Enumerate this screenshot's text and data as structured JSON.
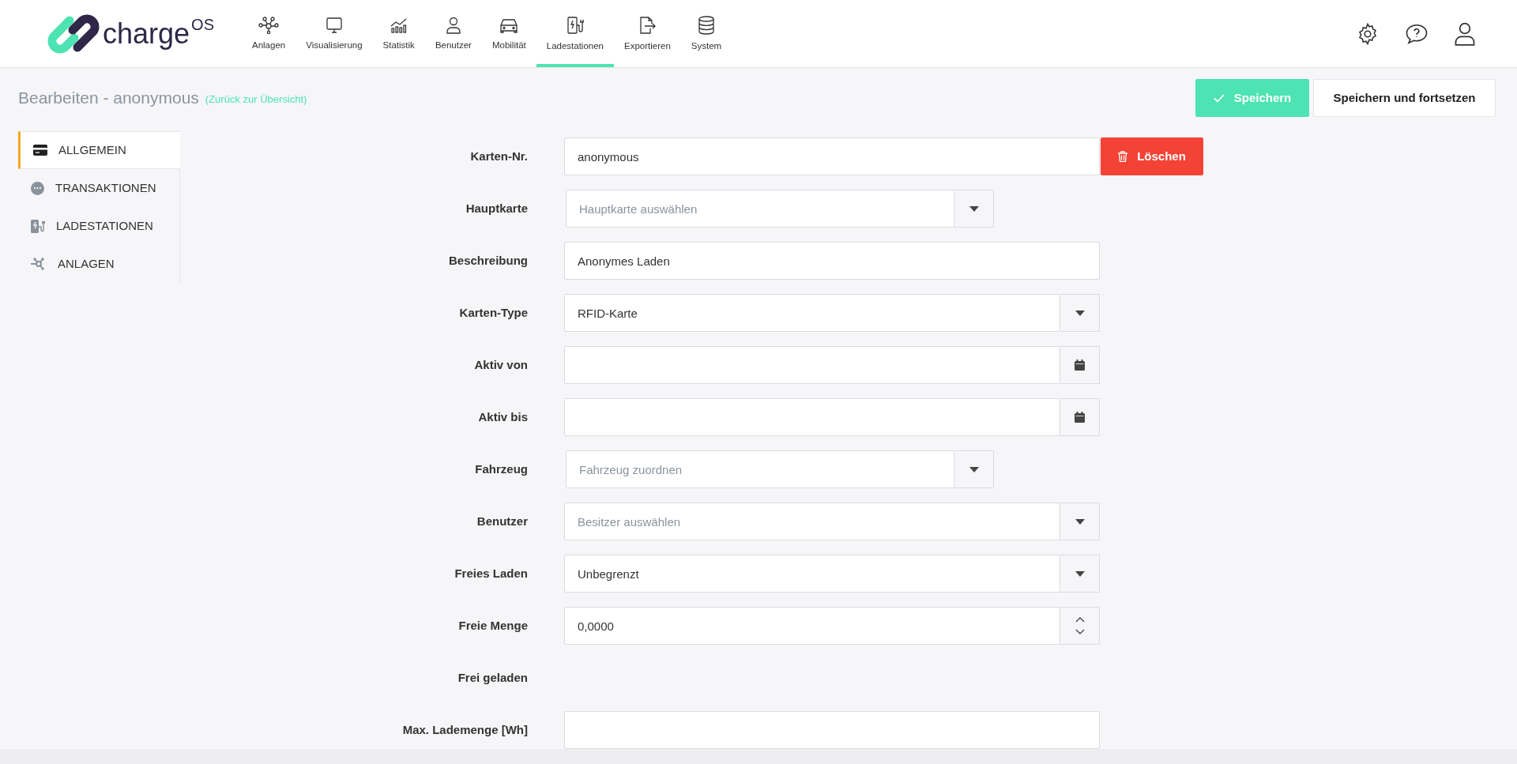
{
  "logo": {
    "text": "charge",
    "superscript": "OS"
  },
  "nav": [
    {
      "label": "Anlagen",
      "selected": false
    },
    {
      "label": "Visualisierung",
      "selected": false
    },
    {
      "label": "Statistik",
      "selected": false
    },
    {
      "label": "Benutzer",
      "selected": false
    },
    {
      "label": "Mobilität",
      "selected": false
    },
    {
      "label": "Ladestationen",
      "selected": true
    },
    {
      "label": "Exportieren",
      "selected": false
    },
    {
      "label": "System",
      "selected": false
    }
  ],
  "page": {
    "title": "Bearbeiten - anonymous",
    "back_link": "(Zurück zur Übersicht)"
  },
  "actions": [
    {
      "label": "Speichern",
      "kind": "primary"
    },
    {
      "label": "Speichern und fortsetzen",
      "kind": "secondary"
    }
  ],
  "sidebar": [
    {
      "label": "ALLGEMEIN",
      "selected": true
    },
    {
      "label": "TRANSAKTIONEN",
      "selected": false
    },
    {
      "label": "LADESTATIONEN",
      "selected": false
    },
    {
      "label": "ANLAGEN",
      "selected": false
    }
  ],
  "form": [
    {
      "label": "Karten-Nr.",
      "kind": "text",
      "value": "anonymous",
      "delete_button": "Löschen"
    },
    {
      "label": "Hauptkarte",
      "kind": "lookup",
      "placeholder": "Hauptkarte auswählen"
    },
    {
      "label": "Beschreibung",
      "kind": "text",
      "value": "Anonymes Laden"
    },
    {
      "label": "Karten-Type",
      "kind": "select",
      "value": "RFID-Karte"
    },
    {
      "label": "Aktiv von",
      "kind": "date"
    },
    {
      "label": "Aktiv bis",
      "kind": "date"
    },
    {
      "label": "Fahrzeug",
      "kind": "lookup",
      "placeholder": "Fahrzeug zuordnen"
    },
    {
      "label": "Benutzer",
      "kind": "select",
      "placeholder": "Besitzer auswählen"
    },
    {
      "label": "Freies Laden",
      "kind": "select",
      "value": "Unbegrenzt"
    },
    {
      "label": "Freie Menge",
      "kind": "number",
      "value": "0,0000"
    },
    {
      "label": "Frei geladen",
      "kind": "static"
    },
    {
      "label": "Max. Lademenge [Wh]",
      "kind": "text"
    }
  ]
}
